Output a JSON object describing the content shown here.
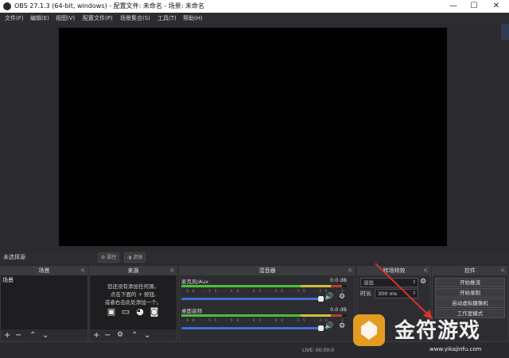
{
  "window": {
    "title": "OBS 27.1.3 (64-bit, windows) - 配置文件: 未命名 - 场景: 未命名",
    "controls": [
      "—",
      "☐",
      "✕"
    ]
  },
  "menu": [
    "文件(F)",
    "编辑(E)",
    "视图(V)",
    "配置文件(P)",
    "场景集合(S)",
    "工具(T)",
    "帮助(H)"
  ],
  "source_bar": {
    "label": "未选择源",
    "properties": "属性",
    "filters": "滤镜"
  },
  "docks": {
    "scenes": {
      "title": "场景",
      "items": [
        "场景"
      ]
    },
    "sources": {
      "title": "来源",
      "hint": [
        "您还没有添加任何源。",
        "点击下面的 + 按钮,",
        "或者右击此处添加一个。"
      ]
    },
    "mixer": {
      "title": "混音器",
      "channels": [
        {
          "name": "麦克风/Aux",
          "db": "0.0 dB"
        },
        {
          "name": "桌面音频",
          "db": "0.0 dB"
        }
      ],
      "scale": "-60 -55 -50 -45 -40 -35 -30 -25 -20 -15 -10 -5 0"
    },
    "transitions": {
      "title": "转场特效",
      "type_value": "淡出",
      "duration_label": "时长",
      "duration_value": "300 ms"
    },
    "controls": {
      "title": "控件",
      "buttons": [
        "开始推流",
        "开始录制",
        "启动虚拟摄像机",
        "工作室模式"
      ]
    }
  },
  "status": {
    "live": "LIVE: 00:00:0"
  },
  "watermark": {
    "title": "金符游戏",
    "url": "www.yikajinfu.com"
  },
  "colors": {
    "accent": "#3d6fd6",
    "preview": "#000000",
    "annotation_arrow": "#d9322a"
  }
}
